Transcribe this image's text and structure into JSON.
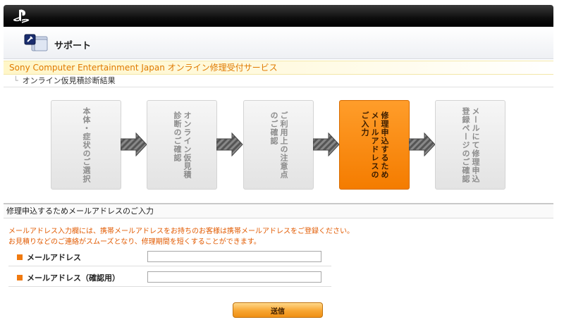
{
  "header": {
    "logo_icon": "playstation-logo-icon",
    "support_icon": "support-folder-icon",
    "support_label": "サポート"
  },
  "service_title": "Sony Computer Entertainment Japan オンライン修理受付サービス",
  "breadcrumb": {
    "label": "オンライン仮見積診断結果"
  },
  "steps": [
    {
      "label": "本体・症状のご選択",
      "active": false
    },
    {
      "label": "オンライン仮見積\n診断のご確認",
      "active": false
    },
    {
      "label": "ご利用上の注意点\nのご確認",
      "active": false
    },
    {
      "label": "修理申込するため\nメールアドレスの\nご入力",
      "active": true
    },
    {
      "label": "メールにて修理申込\n登録ページのご確認",
      "active": false
    }
  ],
  "section": {
    "title": "修理申込するためメールアドレスのご入力",
    "notice_line1": "メールアドレス入力欄には、携帯メールアドレスをお持ちのお客様は携帯メールアドレスをご登録ください。",
    "notice_line2": "お見積りなどのご連絡がスムーズとなり、修理期間を短くすることができます。"
  },
  "form": {
    "email_label": "メールアドレス",
    "email_value": "",
    "email_confirm_label": "メールアドレス（確認用）",
    "email_confirm_value": "",
    "submit_label": "送信"
  },
  "colors": {
    "accent_orange": "#f47c00",
    "notice_text": "#e25a00",
    "title_text": "#e07a00"
  }
}
